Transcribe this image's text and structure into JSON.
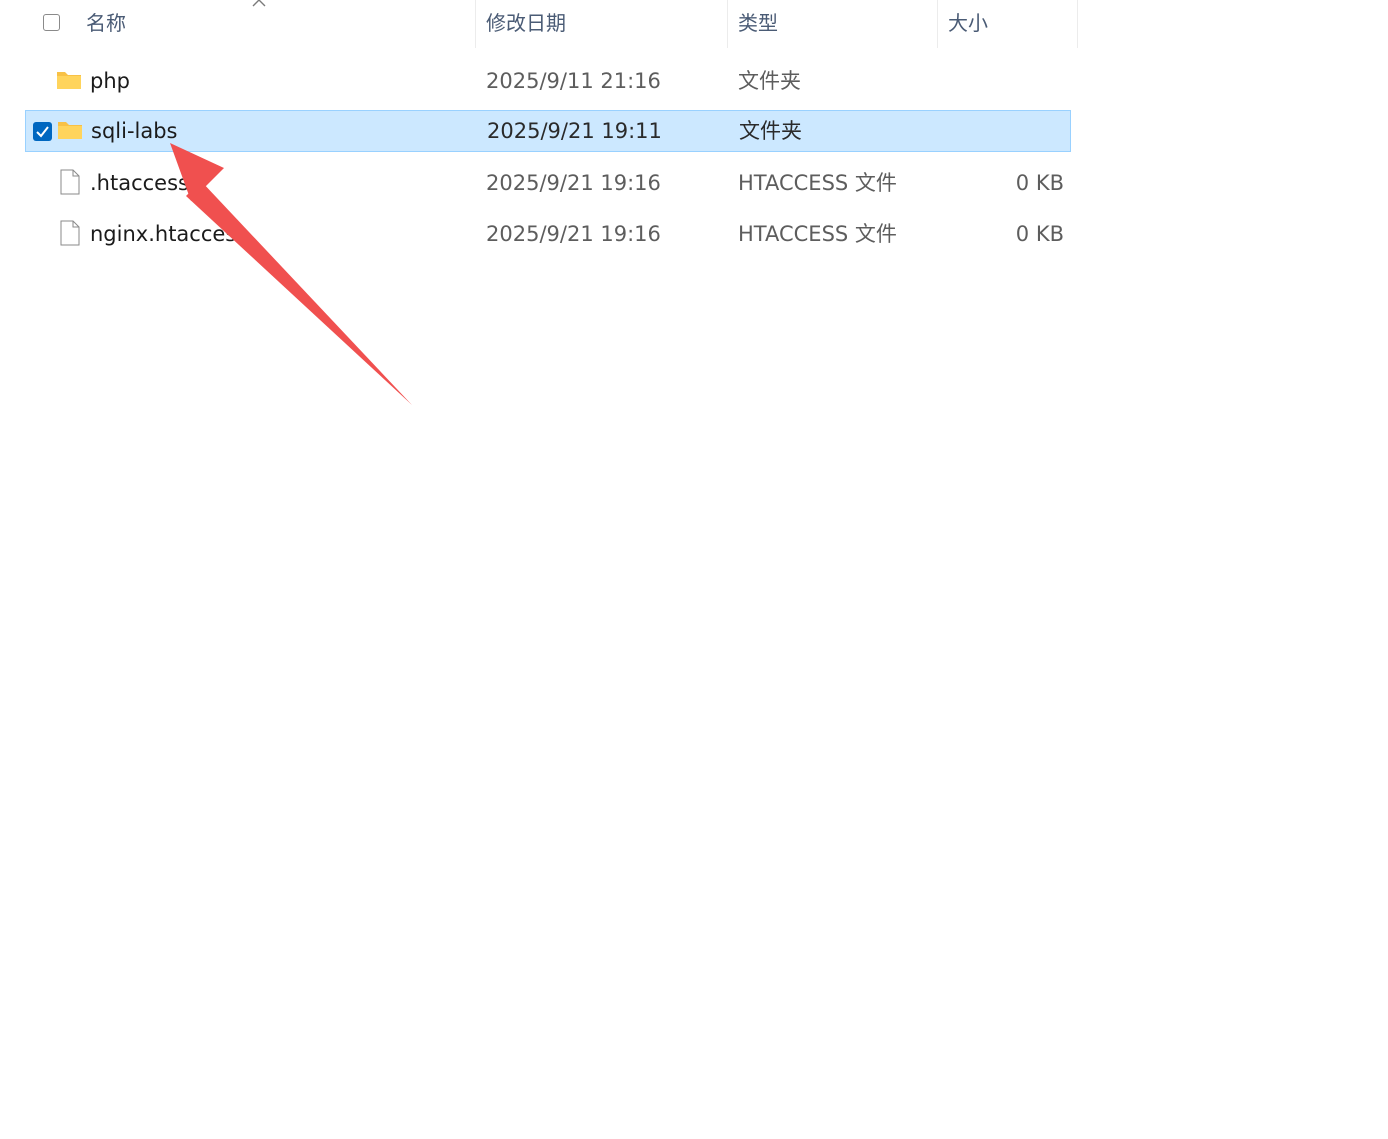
{
  "header": {
    "name": "名称",
    "date_modified": "修改日期",
    "type": "类型",
    "size": "大小"
  },
  "rows": [
    {
      "name": "php",
      "date": "2025/9/11 21:16",
      "type": "文件夹",
      "size": "",
      "icon": "folder-icon",
      "selected": false
    },
    {
      "name": "sqli-labs",
      "date": "2025/9/21 19:11",
      "type": "文件夹",
      "size": "",
      "icon": "folder-icon",
      "selected": true
    },
    {
      "name": ".htaccess",
      "date": "2025/9/21 19:16",
      "type": "HTACCESS 文件",
      "size": "0 KB",
      "icon": "file-icon",
      "selected": false
    },
    {
      "name": "nginx.htaccess",
      "date": "2025/9/21 19:16",
      "type": "HTACCESS 文件",
      "size": "0 KB",
      "icon": "file-icon",
      "selected": false
    }
  ],
  "colors": {
    "selection_bg": "#cce8ff",
    "selection_border": "#99d1ff",
    "checkbox_accent": "#0067c0",
    "annotation_arrow": "#f0504f",
    "folder": "#ffd45c"
  },
  "annotation": {
    "type": "arrow",
    "points_to": "sqli-labs"
  }
}
